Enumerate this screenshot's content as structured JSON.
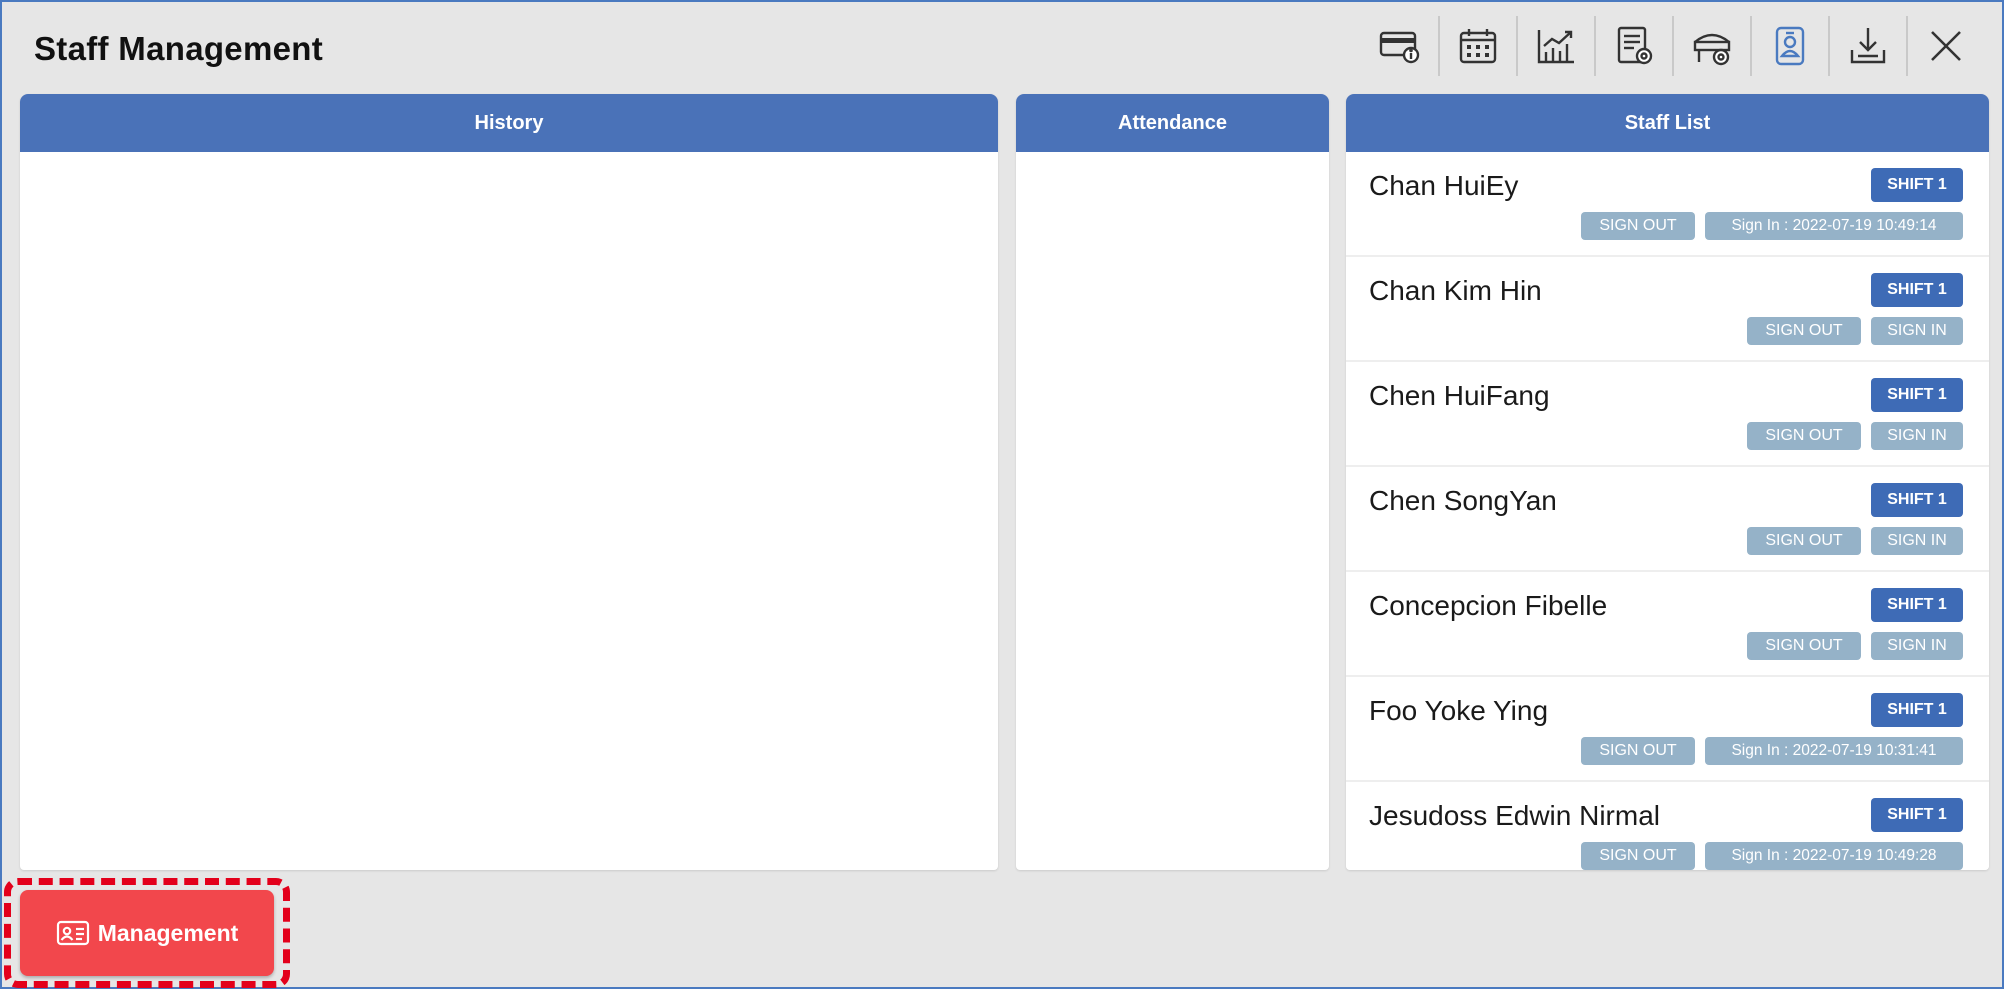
{
  "window": {
    "title": "Staff Management"
  },
  "toolbar": {
    "buttons": [
      {
        "icon": "card-info-icon"
      },
      {
        "icon": "calendar-icon"
      },
      {
        "icon": "chart-icon"
      },
      {
        "icon": "report-settings-icon"
      },
      {
        "icon": "kiosk-settings-icon"
      },
      {
        "icon": "staff-badge-icon"
      },
      {
        "icon": "download-icon"
      },
      {
        "icon": "close-icon"
      }
    ]
  },
  "panels": {
    "history": {
      "title": "History"
    },
    "attendance": {
      "title": "Attendance"
    },
    "staff_list": {
      "title": "Staff List"
    }
  },
  "staff": [
    {
      "name": "Chan HuiEy",
      "shift": "SHIFT 1",
      "sign_out": "SIGN OUT",
      "sign_in": "Sign In : 2022-07-19 10:49:14",
      "signed_in": true
    },
    {
      "name": "Chan Kim Hin",
      "shift": "SHIFT 1",
      "sign_out": "SIGN OUT",
      "sign_in": "SIGN IN",
      "signed_in": false
    },
    {
      "name": "Chen HuiFang",
      "shift": "SHIFT 1",
      "sign_out": "SIGN OUT",
      "sign_in": "SIGN IN",
      "signed_in": false
    },
    {
      "name": "Chen SongYan",
      "shift": "SHIFT 1",
      "sign_out": "SIGN OUT",
      "sign_in": "SIGN IN",
      "signed_in": false
    },
    {
      "name": "Concepcion Fibelle",
      "shift": "SHIFT 1",
      "sign_out": "SIGN OUT",
      "sign_in": "SIGN IN",
      "signed_in": false
    },
    {
      "name": "Foo Yoke Ying",
      "shift": "SHIFT 1",
      "sign_out": "SIGN OUT",
      "sign_in": "Sign In : 2022-07-19 10:31:41",
      "signed_in": true
    },
    {
      "name": "Jesudoss Edwin Nirmal",
      "shift": "SHIFT 1",
      "sign_out": "SIGN OUT",
      "sign_in": "Sign In : 2022-07-19 10:49:28",
      "signed_in": true
    }
  ],
  "footer": {
    "management_label": "Management",
    "icon": "contact-card-icon"
  },
  "colors": {
    "header_blue": "#4a72b8",
    "shift_badge": "#3e6bb6",
    "chip": "#95b2c8",
    "management": "#f2474c",
    "highlight": "#e3001b"
  }
}
